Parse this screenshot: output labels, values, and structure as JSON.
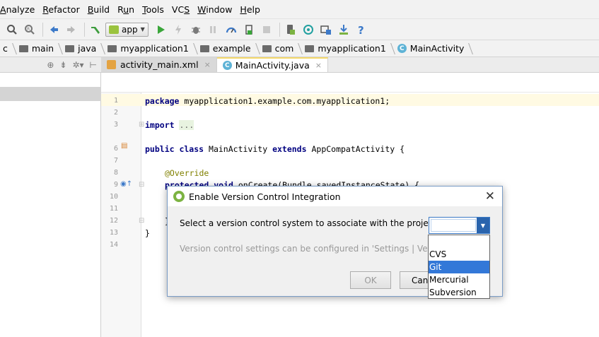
{
  "menu": [
    {
      "label": "Analyze",
      "mn": "A"
    },
    {
      "label": "Refactor",
      "mn": "R"
    },
    {
      "label": "Build",
      "mn": "B"
    },
    {
      "label": "Run",
      "mn": "u"
    },
    {
      "label": "Tools",
      "mn": "T"
    },
    {
      "label": "VCS",
      "mn": "S"
    },
    {
      "label": "Window",
      "mn": "W"
    },
    {
      "label": "Help",
      "mn": "H"
    }
  ],
  "toolbar": {
    "run_config": "app"
  },
  "breadcrumb": [
    "c",
    "main",
    "java",
    "myapplication1",
    "example",
    "com",
    "myapplication1",
    "MainActivity"
  ],
  "tabs": [
    {
      "label": "activity_main.xml",
      "close": "×"
    },
    {
      "label": "MainActivity.java",
      "close": "×"
    }
  ],
  "editor": {
    "line_numbers": [
      "1",
      "2",
      "3",
      "6",
      "7",
      "8",
      "9",
      "10",
      "11",
      "12",
      "13",
      "14"
    ],
    "code": {
      "l1": "myapplication1.example.com.myapplication1;",
      "l1_kw": "package",
      "l3_kw": "import",
      "l3": "...",
      "l6_kw1": "public class",
      "l6_a": "MainActivity",
      "l6_kw2": "extends",
      "l6_b": "AppCompatActivity {",
      "l8": "@Override",
      "l9_kw": "protected void",
      "l9": "onCreate(Bundle savedInstanceState) {",
      "l12": "}",
      "l13": "}"
    }
  },
  "dialog": {
    "title": "Enable Version Control Integration",
    "close": "✕",
    "label": "Select a version control system to associate with the project root:",
    "hint": "Version control settings can be configured in 'Settings | Version Co",
    "ok": "OK",
    "cancel": "Canc",
    "options": [
      "CVS",
      "Git",
      "Mercurial",
      "Subversion"
    ],
    "selected_option": "Git"
  }
}
